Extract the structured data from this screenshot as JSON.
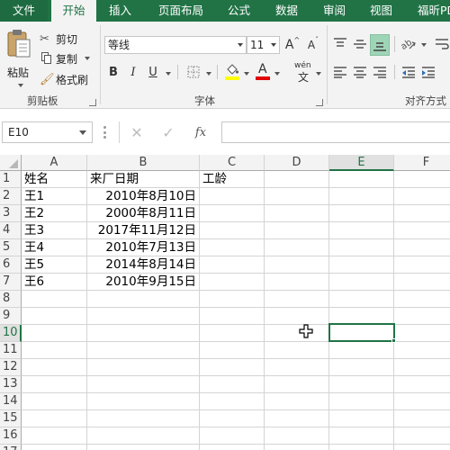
{
  "tabs": {
    "file": "文件",
    "home": "开始",
    "insert": "插入",
    "page_layout": "页面布局",
    "formulas": "公式",
    "data": "数据",
    "review": "审阅",
    "view": "视图",
    "foxit": "福昕PD"
  },
  "ribbon": {
    "clipboard": {
      "paste": "粘贴",
      "cut": "剪切",
      "copy": "复制",
      "format_painter": "格式刷",
      "group_label": "剪贴板"
    },
    "font": {
      "font_name": "等线",
      "font_size": "11",
      "bold": "B",
      "italic": "I",
      "underline": "U",
      "grow_font": "A",
      "shrink_font": "A",
      "font_color_glyph": "A",
      "phonetic": "wén",
      "group_label": "字体"
    },
    "alignment": {
      "group_label": "对齐方式"
    }
  },
  "formula_bar": {
    "name_box": "E10",
    "fx": "fx",
    "value": ""
  },
  "sheet": {
    "columns": [
      "A",
      "B",
      "C",
      "D",
      "E",
      "F"
    ],
    "selected_column": "E",
    "rows": [
      "1",
      "2",
      "3",
      "4",
      "5",
      "6",
      "7",
      "8",
      "9",
      "10",
      "11",
      "12",
      "13",
      "14",
      "15",
      "16",
      "17"
    ],
    "selected_row": "10",
    "headers": {
      "name": "姓名",
      "date": "来厂日期",
      "tenure": "工龄"
    },
    "records": [
      {
        "name": "王1",
        "date": "2010年8月10日"
      },
      {
        "name": "王2",
        "date": "2000年8月11日"
      },
      {
        "name": "王3",
        "date": "2017年11月12日"
      },
      {
        "name": "王4",
        "date": "2010年7月13日"
      },
      {
        "name": "王5",
        "date": "2014年8月14日"
      },
      {
        "name": "王6",
        "date": "2010年9月15日"
      }
    ],
    "active_cell": "E10"
  },
  "colors": {
    "accent": "#217346",
    "ribbon_bg": "#f3f3f3",
    "gridline": "#d4d4d4"
  }
}
